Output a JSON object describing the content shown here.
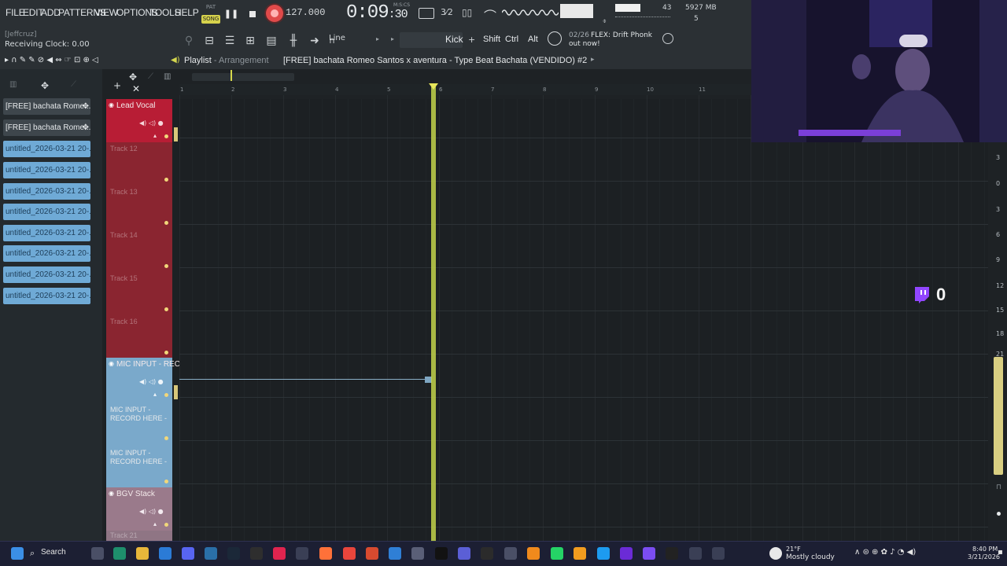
{
  "menu": [
    "FILE",
    "EDIT",
    "ADD",
    "PATTERNS",
    "VIEW",
    "OPTIONS",
    "TOOLS",
    "HELP"
  ],
  "transport": {
    "pat_label": "PAT",
    "song_label": "SONG",
    "tempo": "127.000",
    "time_main": "0:09",
    "time_sub": ":30",
    "time_unit": "M:S:CS",
    "cpu_value": "43",
    "memory": "5927 MB",
    "poly": "5"
  },
  "toolbar": {
    "user": "[Jeffcruz]",
    "receiving_clock": "Receiving Clock: 0.00",
    "snap": "Line",
    "channel": "Kick",
    "plus": "+",
    "keys": [
      "Shift",
      "Ctrl",
      "Alt"
    ],
    "news_count": "02/26",
    "news_line1": "FLEX: Drift Phonk",
    "news_line2": "out now!"
  },
  "playlist": {
    "title": "Playlist",
    "subtitle": "- Arrangement",
    "project": "[FREE] bachata Romeo Santos x aventura - Type Beat Bachata (VENDIDO) #2",
    "ruler": [
      "1",
      "2",
      "3",
      "4",
      "5",
      "6",
      "7",
      "8",
      "9",
      "10",
      "11"
    ]
  },
  "browser": {
    "items": [
      {
        "label": "[FREE] bachata Rome...",
        "kind": "audio"
      },
      {
        "label": "[FREE] bachata Rome...",
        "kind": "audio"
      },
      {
        "label": "untitled_2026-03-21 20-...",
        "kind": "untitled"
      },
      {
        "label": "untitled_2026-03-21 20-...",
        "kind": "untitled"
      },
      {
        "label": "untitled_2026-03-21 20-...",
        "kind": "untitled"
      },
      {
        "label": "untitled_2026-03-21 20-...",
        "kind": "untitled"
      },
      {
        "label": "untitled_2026-03-21 20-...",
        "kind": "untitled"
      },
      {
        "label": "untitled_2026-03-21 20-...",
        "kind": "untitled"
      },
      {
        "label": "untitled_2026-03-21 20-...",
        "kind": "untitled"
      },
      {
        "label": "untitled_2026-03-21 20-...",
        "kind": "untitled"
      }
    ]
  },
  "tracks": {
    "lead_vocal": "Lead Vocal",
    "t12": "Track 12",
    "t13": "Track 13",
    "t14": "Track 14",
    "t15": "Track 15",
    "t16": "Track 16",
    "mic_input": "MIC INPUT - REC...",
    "mic_line1_a": "MIC INPUT -",
    "mic_line1_b": "RECORD HERE -",
    "mic_line2_a": "MIC INPUT -",
    "mic_line2_b": "RECORD HERE -",
    "bgv_stack": "BGV Stack",
    "t21": "Track 21"
  },
  "overlay": {
    "twitch_count": "0"
  },
  "right_scale": [
    "3",
    "0",
    "3",
    "6",
    "9",
    "12",
    "15",
    "18",
    "21"
  ],
  "taskbar": {
    "search": "Search",
    "temp": "21°F",
    "weather": "Mostly cloudy",
    "time": "8:40 PM",
    "date": "3/21/2026"
  },
  "colors": {
    "lead_vocal": "#b81d35",
    "track_red": "#8a2530",
    "mic_input": "#7aa9cb",
    "bgv": "#9a7a8b",
    "playhead": "#c2d34a"
  }
}
